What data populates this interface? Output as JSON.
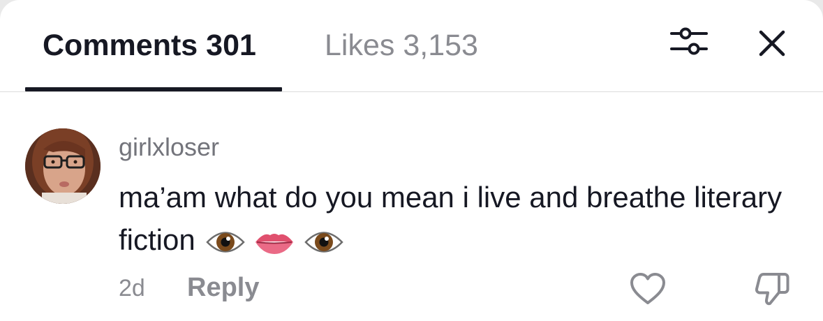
{
  "tabs": {
    "comments_label": "Comments 301",
    "likes_label": "Likes 3,153",
    "active": "comments"
  },
  "header_icons": {
    "filter": "sliders-icon",
    "close": "close-icon"
  },
  "comment": {
    "username": "girlxloser",
    "text": "ma’am what do you mean i live and breathe literary fiction",
    "emojis": [
      "eye-emoji",
      "lips-emoji",
      "eye-emoji"
    ],
    "time": "2d",
    "reply_label": "Reply",
    "like_icon": "heart-outline-icon",
    "dislike_icon": "thumbs-down-outline-icon"
  },
  "colors": {
    "primary_text": "#161823",
    "secondary_text": "#8a8b91",
    "divider": "#dcdcdc",
    "background": "#ffffff"
  }
}
